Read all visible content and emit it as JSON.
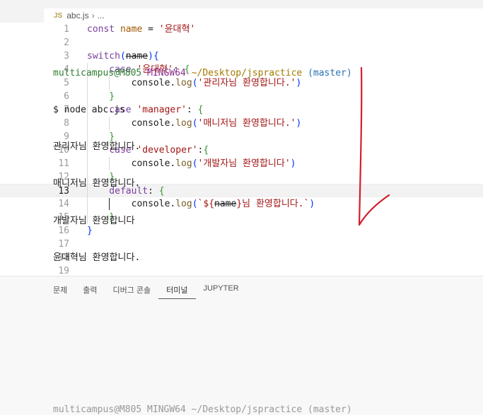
{
  "breadcrumb": {
    "icon": "JS",
    "file": "abc.js",
    "separator": "›",
    "ellipsis": "..."
  },
  "editor": {
    "lines": [
      {
        "n": "1",
        "tokens": [
          {
            "t": "const ",
            "c": "kw"
          },
          {
            "t": "name",
            "c": "var"
          },
          {
            "t": " = ",
            "c": "op"
          },
          {
            "t": "'윤대혁'",
            "c": "str"
          }
        ]
      },
      {
        "n": "2",
        "tokens": []
      },
      {
        "n": "3",
        "tokens": [
          {
            "t": "switch",
            "c": "kw"
          },
          {
            "t": "(",
            "c": "paren"
          },
          {
            "t": "name",
            "c": "strike"
          },
          {
            "t": ")",
            "c": "paren"
          },
          {
            "t": "{",
            "c": "paren"
          }
        ]
      },
      {
        "n": "4",
        "tokens": [
          {
            "t": "    case ",
            "c": "kw"
          },
          {
            "t": "'윤대혁'",
            "c": "str"
          },
          {
            "t": ": ",
            "c": "op"
          },
          {
            "t": "{",
            "c": "brace"
          }
        ]
      },
      {
        "n": "5",
        "tokens": [
          {
            "t": "        console",
            "c": "obj"
          },
          {
            "t": ".",
            "c": "op"
          },
          {
            "t": "log",
            "c": "fn"
          },
          {
            "t": "(",
            "c": "paren"
          },
          {
            "t": "'관리자님 환영합니다.'",
            "c": "str"
          },
          {
            "t": ")",
            "c": "paren"
          }
        ]
      },
      {
        "n": "6",
        "tokens": [
          {
            "t": "    }",
            "c": "brace"
          }
        ]
      },
      {
        "n": "7",
        "tokens": [
          {
            "t": "    case ",
            "c": "kw"
          },
          {
            "t": "'manager'",
            "c": "str"
          },
          {
            "t": ": ",
            "c": "op"
          },
          {
            "t": "{",
            "c": "brace"
          }
        ]
      },
      {
        "n": "8",
        "tokens": [
          {
            "t": "        console",
            "c": "obj"
          },
          {
            "t": ".",
            "c": "op"
          },
          {
            "t": "log",
            "c": "fn"
          },
          {
            "t": "(",
            "c": "paren"
          },
          {
            "t": "'매니저님 환영합니다.'",
            "c": "str"
          },
          {
            "t": ")",
            "c": "paren"
          }
        ]
      },
      {
        "n": "9",
        "tokens": [
          {
            "t": "    }",
            "c": "brace"
          }
        ]
      },
      {
        "n": "10",
        "tokens": [
          {
            "t": "    case ",
            "c": "kw"
          },
          {
            "t": "'developer'",
            "c": "str"
          },
          {
            "t": ":",
            "c": "op"
          },
          {
            "t": "{",
            "c": "brace"
          }
        ]
      },
      {
        "n": "11",
        "tokens": [
          {
            "t": "        console",
            "c": "obj"
          },
          {
            "t": ".",
            "c": "op"
          },
          {
            "t": "log",
            "c": "fn"
          },
          {
            "t": "(",
            "c": "paren"
          },
          {
            "t": "'개발자님 환영합니다'",
            "c": "str"
          },
          {
            "t": ")",
            "c": "paren"
          }
        ]
      },
      {
        "n": "12",
        "tokens": [
          {
            "t": "    }",
            "c": "brace"
          }
        ]
      },
      {
        "n": "13",
        "tokens": [
          {
            "t": "    default",
            "c": "kw"
          },
          {
            "t": ": ",
            "c": "op"
          },
          {
            "t": "{",
            "c": "brace"
          }
        ],
        "current": true
      },
      {
        "n": "14",
        "tokens": [
          {
            "t": "        console",
            "c": "obj"
          },
          {
            "t": ".",
            "c": "op"
          },
          {
            "t": "log",
            "c": "fn"
          },
          {
            "t": "(",
            "c": "paren"
          },
          {
            "t": "`${",
            "c": "str"
          },
          {
            "t": "name",
            "c": "strike"
          },
          {
            "t": "}님 환영합니다.`",
            "c": "str"
          },
          {
            "t": ")",
            "c": "paren"
          }
        ]
      },
      {
        "n": "15",
        "tokens": [
          {
            "t": "    }",
            "c": "brace"
          }
        ]
      },
      {
        "n": "16",
        "tokens": [
          {
            "t": "}",
            "c": "paren"
          }
        ]
      },
      {
        "n": "17",
        "tokens": []
      },
      {
        "n": "18",
        "tokens": []
      },
      {
        "n": "19",
        "tokens": []
      }
    ]
  },
  "panel": {
    "tabs": [
      {
        "label": "문제",
        "active": false
      },
      {
        "label": "출력",
        "active": false
      },
      {
        "label": "디버그 콘솔",
        "active": false
      },
      {
        "label": "터미널",
        "active": true
      },
      {
        "label": "JUPYTER",
        "active": false
      }
    ]
  },
  "terminal": {
    "prompt": {
      "user": "multicampus@M805",
      "shell": "MINGW64",
      "path": "~/Desktop/jspractice",
      "branch": "(master)"
    },
    "command": "$ node abc.js",
    "output": [
      "관리자님 환영합니다.",
      "매니저님 환영합니다.",
      "개발자님 환영합니다",
      "윤대혁님 환영합니다."
    ],
    "partial_prompt": "multicampus@M805 MINGW64 ~/Desktop/jspractice (master)"
  },
  "colors": {
    "annotation": "#d0202a"
  },
  "icons": {
    "file_icon": "js-file-icon",
    "annotation": "red-arrow-annotation"
  }
}
